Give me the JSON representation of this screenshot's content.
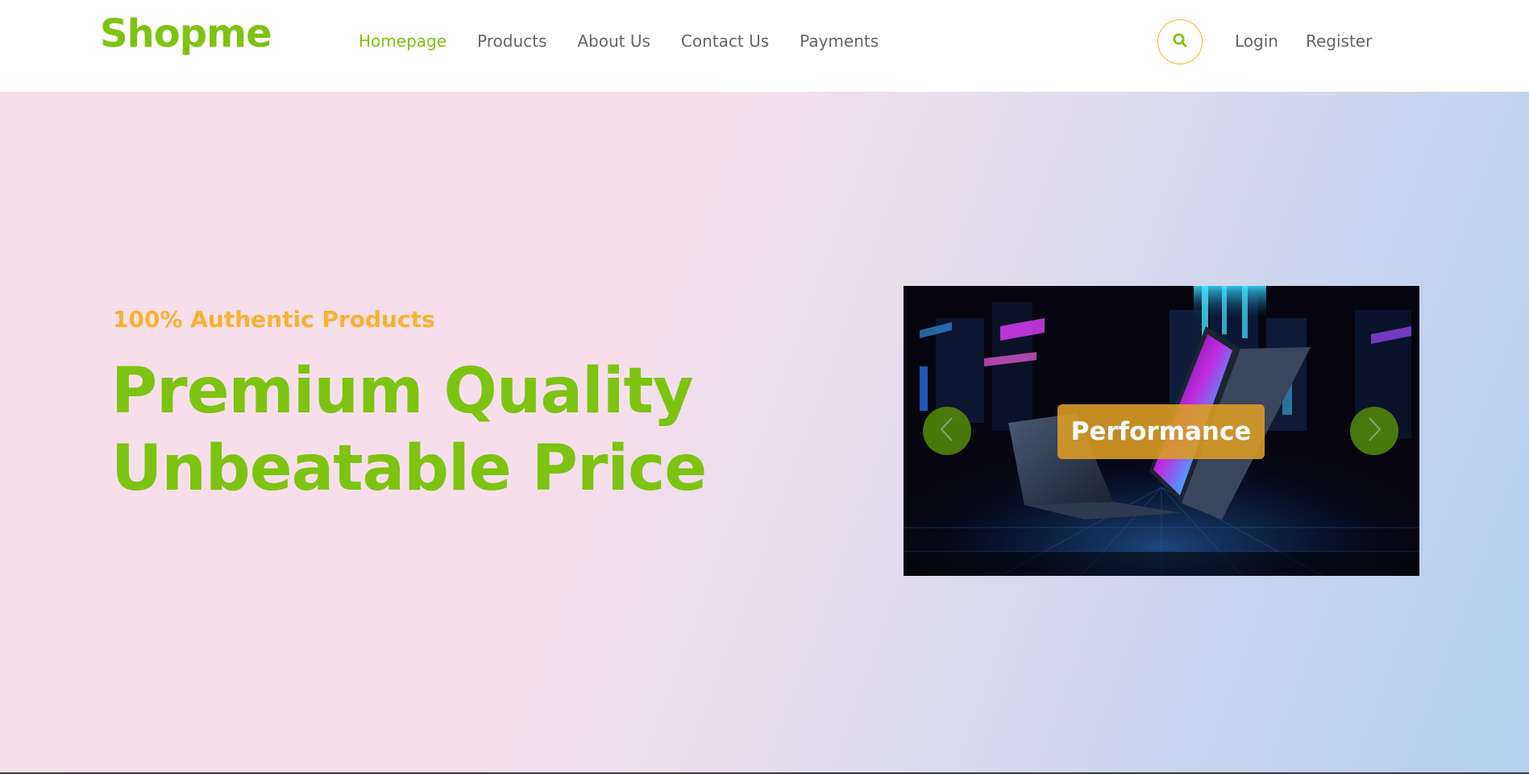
{
  "brand": {
    "logo_text": "Shopme",
    "accent_color": "#7ec311",
    "secondary_color": "#f6b232"
  },
  "nav": {
    "items": [
      {
        "label": "Homepage",
        "active": true
      },
      {
        "label": "Products",
        "active": false
      },
      {
        "label": "About Us",
        "active": false
      },
      {
        "label": "Contact Us",
        "active": false
      },
      {
        "label": "Payments",
        "active": false
      }
    ],
    "search_icon": "search-icon",
    "login_label": "Login",
    "register_label": "Register"
  },
  "hero": {
    "tagline": "100% Authentic Products",
    "headline_line1": "Premium Quality",
    "headline_line2": "Unbeatable Price"
  },
  "carousel": {
    "caption": "Performance",
    "prev_icon": "chevron-left-icon",
    "next_icon": "chevron-right-icon",
    "image": "gaming-laptops-neon-scene"
  }
}
